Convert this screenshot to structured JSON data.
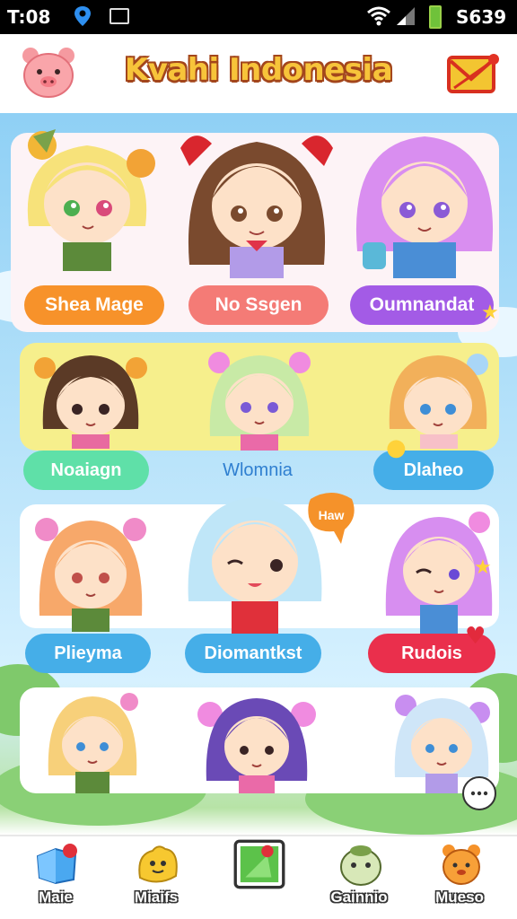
{
  "status_bar": {
    "time": "T:08",
    "clock": "S639"
  },
  "header": {
    "title": "Kvahi Indonesia"
  },
  "sections": [
    {
      "labels": [
        "Shea Mage",
        "No Ssgen",
        "Oumnandat"
      ]
    },
    {
      "labels": [
        "Noaiagn",
        "Wlomnia",
        "Dlaheo"
      ]
    },
    {
      "labels": [
        "Plieyma",
        "Diomantkst",
        "Rudois"
      ],
      "speech_bubble": "Haw"
    },
    {
      "labels": []
    }
  ],
  "bottom_nav": [
    {
      "label": "Maie",
      "icon": "map-icon"
    },
    {
      "label": "Miaifs",
      "icon": "yellow-blob-icon"
    },
    {
      "label": "",
      "icon": "play-tile-icon"
    },
    {
      "label": "Gainnio",
      "icon": "green-creature-icon"
    },
    {
      "label": "Mueso",
      "icon": "orange-bear-icon"
    }
  ],
  "colors": {
    "title_fill": "#f7c43a",
    "title_outline": "#a3461c",
    "pill_orange": "#f7922a",
    "pill_salmon": "#f47b76",
    "pill_purple": "#a35be6",
    "pill_mint": "#5fe0a8",
    "pill_blue": "#45aee8",
    "pill_red": "#ea2f4c"
  }
}
